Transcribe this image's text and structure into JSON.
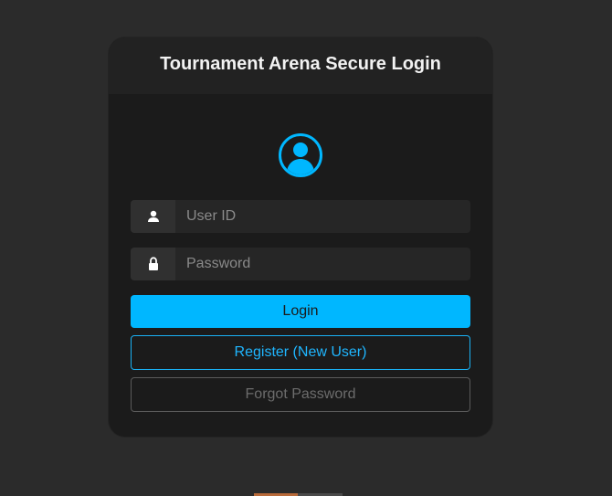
{
  "header": {
    "title": "Tournament Arena Secure Login"
  },
  "avatar": {
    "icon": "user-circle-icon",
    "color": "#00b7ff"
  },
  "form": {
    "user_id": {
      "placeholder": "User ID",
      "value": "",
      "icon": "user-icon"
    },
    "password": {
      "placeholder": "Password",
      "value": "",
      "icon": "lock-icon"
    }
  },
  "buttons": {
    "login_label": "Login",
    "register_label": "Register (New User)",
    "forgot_label": "Forgot Password"
  },
  "colors": {
    "accent": "#00b7ff",
    "background": "#2b2b2b",
    "card": "#1b1b1b"
  }
}
